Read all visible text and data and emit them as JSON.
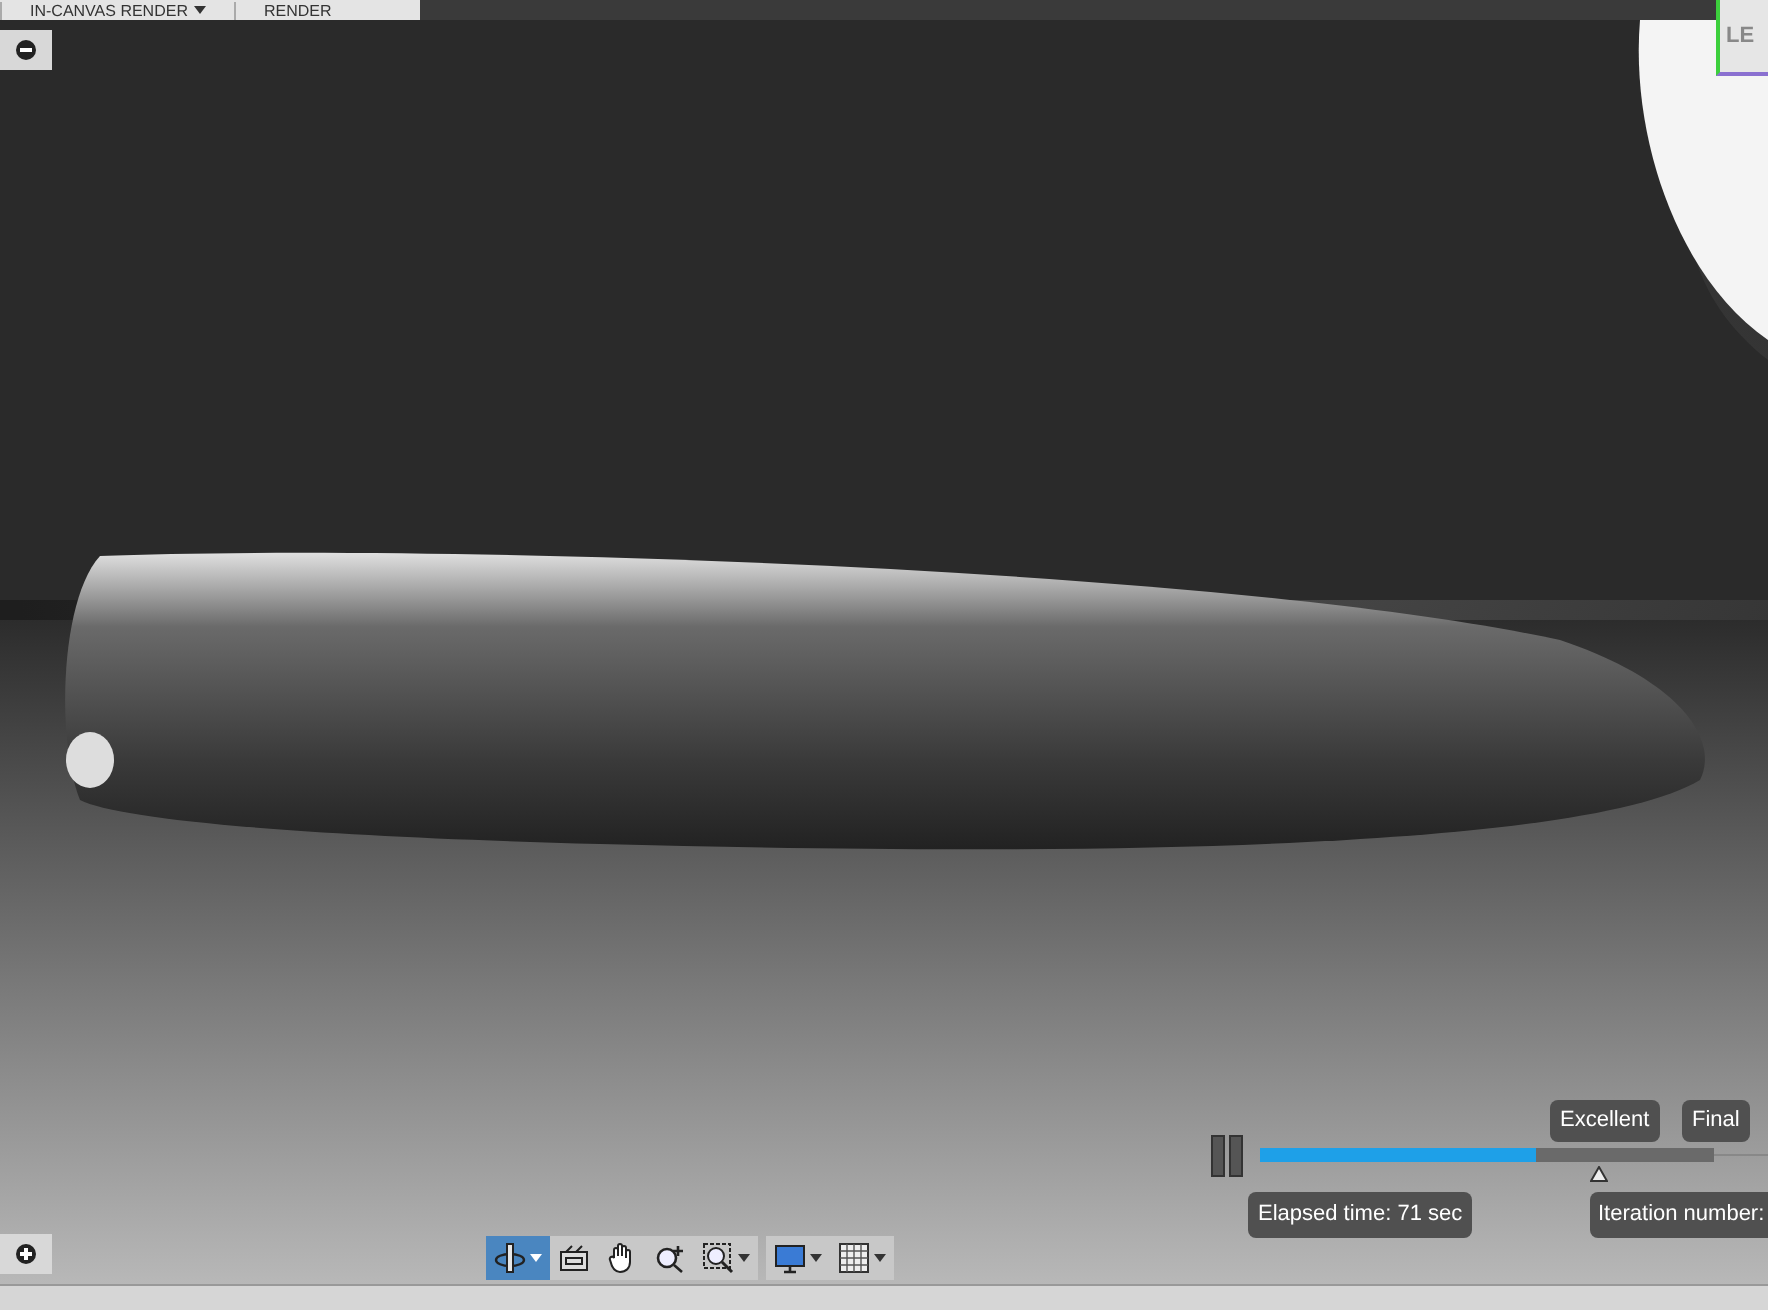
{
  "menu_bar": {
    "tabs": [
      {
        "label": "IN-CANVAS RENDER",
        "has_menu": true
      },
      {
        "label": "RENDER",
        "has_menu": false
      }
    ]
  },
  "view_cube": {
    "label": "LE"
  },
  "render_progress": {
    "level": 0.61,
    "milestones": [
      {
        "label": "Excellent"
      },
      {
        "label": "Final"
      }
    ],
    "elapsed": "Elapsed time: 71 sec",
    "iteration": "Iteration number:"
  },
  "navigation_toolbar": {
    "tools": [
      {
        "kind": "orbit",
        "selected": true,
        "has_menu": true
      },
      {
        "kind": "look",
        "selected": false,
        "has_menu": false
      },
      {
        "kind": "pan",
        "selected": false,
        "has_menu": false
      },
      {
        "kind": "zoom",
        "selected": false,
        "has_menu": false
      },
      {
        "kind": "fit",
        "selected": false,
        "has_menu": true
      }
    ],
    "display_tools": [
      {
        "kind": "display",
        "selected": false,
        "has_menu": true
      },
      {
        "kind": "grid",
        "selected": false,
        "has_menu": true
      }
    ]
  }
}
